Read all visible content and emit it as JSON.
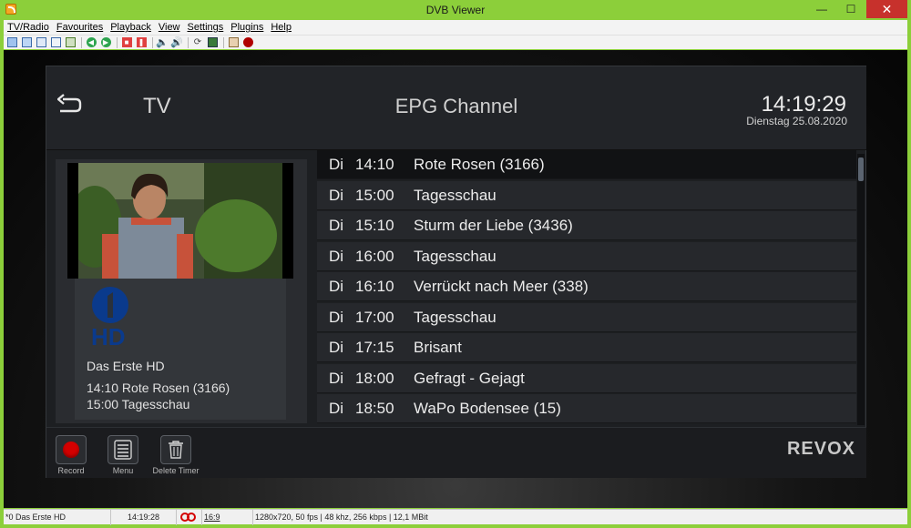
{
  "window": {
    "title": "DVB Viewer"
  },
  "menubar": {
    "items": [
      "TV/Radio",
      "Favourites",
      "Playback",
      "View",
      "Settings",
      "Plugins",
      "Help"
    ]
  },
  "toolbar": {
    "icons": [
      "osd-icon",
      "fullscreen-icon",
      "window-icon",
      "epg-icon",
      "channel-list-icon",
      "previous-icon",
      "next-icon",
      "stop-icon",
      "pause-icon",
      "volume-down-icon",
      "volume-up-icon",
      "timeshift-icon",
      "recordings-icon",
      "settings-icon",
      "record-icon"
    ]
  },
  "header": {
    "back_icon": "back-arrow-icon",
    "mode": "TV",
    "title": "EPG Channel",
    "time": "14:19:29",
    "date": "Dienstag 25.08.2020"
  },
  "channel": {
    "logo_icon": "das-erste-hd-logo",
    "name": "Das Erste HD",
    "now": "14:10 Rote Rosen (3166)",
    "next": "15:00 Tagesschau"
  },
  "epg": {
    "selected_index": 0,
    "items": [
      {
        "day": "Di",
        "time": "14:10",
        "title": "Rote Rosen (3166)"
      },
      {
        "day": "Di",
        "time": "15:00",
        "title": "Tagesschau"
      },
      {
        "day": "Di",
        "time": "15:10",
        "title": "Sturm der Liebe (3436)"
      },
      {
        "day": "Di",
        "time": "16:00",
        "title": "Tagesschau"
      },
      {
        "day": "Di",
        "time": "16:10",
        "title": "Verrückt nach Meer (338)"
      },
      {
        "day": "Di",
        "time": "17:00",
        "title": "Tagesschau"
      },
      {
        "day": "Di",
        "time": "17:15",
        "title": "Brisant"
      },
      {
        "day": "Di",
        "time": "18:00",
        "title": "Gefragt - Gejagt"
      },
      {
        "day": "Di",
        "time": "18:50",
        "title": "WaPo Bodensee (15)"
      }
    ]
  },
  "footer": {
    "record_label": "Record",
    "menu_label": "Menu",
    "delete_timer_label": "Delete Timer",
    "brand": "REVOX"
  },
  "statusbar": {
    "channel": "*0 Das Erste HD",
    "time": "14:19:28",
    "aspect": "16:9",
    "info": "1280x720, 50 fps | 48 khz, 256 kbps | 12,1 MBit"
  },
  "colors": {
    "window_frame": "#8ccf3a",
    "close_button": "#c7312c",
    "record": "#d40000"
  }
}
